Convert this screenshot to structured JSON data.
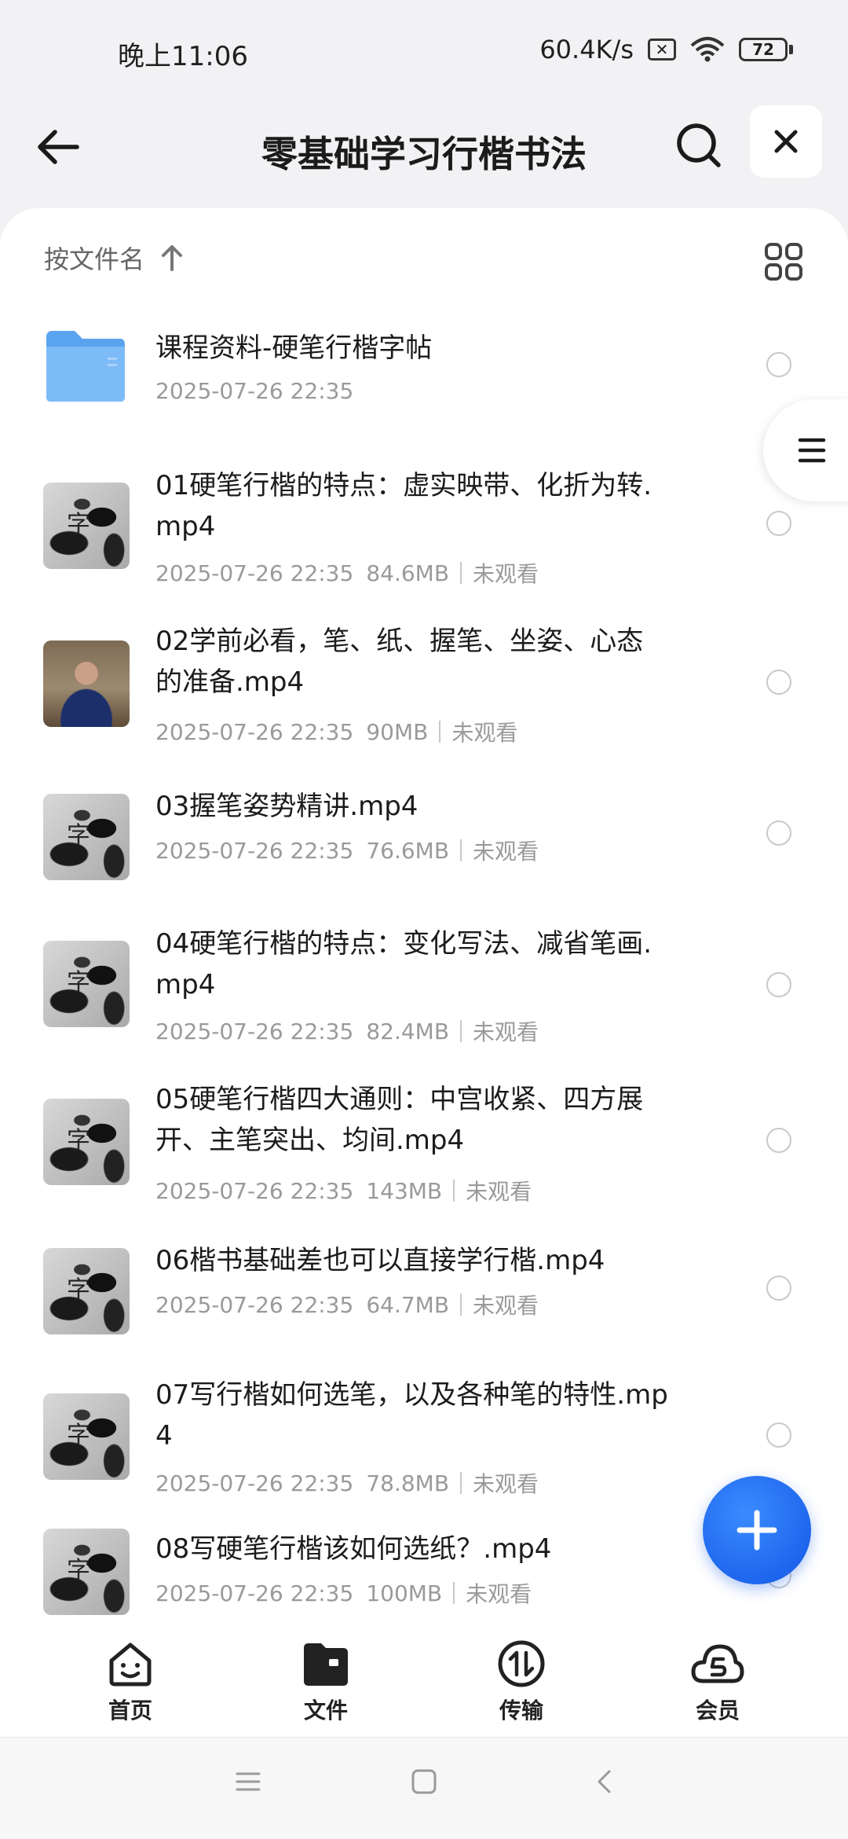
{
  "status": {
    "time": "晚上11:06",
    "speed": "60.4K/s",
    "battery": "72"
  },
  "header": {
    "title": "零基础学习行楷书法"
  },
  "sort": {
    "label": "按文件名"
  },
  "files": [
    {
      "name": "课程资料-硬笔行楷字帖",
      "date": "2025-07-26 22:35",
      "size": "",
      "status": "",
      "kind": "folder"
    },
    {
      "name": "01硬笔行楷的特点：虚实映带、化折为转.mp4",
      "line1": "01硬笔行楷的特点：虚实映带、化折为转.",
      "line2": "mp4",
      "date": "2025-07-26 22:35",
      "size": "84.6MB",
      "status": "未观看",
      "kind": "video"
    },
    {
      "name": "02学前必看，笔、纸、握笔、坐姿、心态的准备.mp4",
      "line1": "02学前必看，笔、纸、握笔、坐姿、心态",
      "line2": "的准备.mp4",
      "date": "2025-07-26 22:35",
      "size": "90MB",
      "status": "未观看",
      "kind": "video"
    },
    {
      "name": "03握笔姿势精讲.mp4",
      "date": "2025-07-26 22:35",
      "size": "76.6MB",
      "status": "未观看",
      "kind": "video"
    },
    {
      "name": "04硬笔行楷的特点：变化写法、减省笔画.mp4",
      "line1": "04硬笔行楷的特点：变化写法、减省笔画.",
      "line2": "mp4",
      "date": "2025-07-26 22:35",
      "size": "82.4MB",
      "status": "未观看",
      "kind": "video"
    },
    {
      "name": "05硬笔行楷四大通则：中宫收紧、四方展开、主笔突出、均间.mp4",
      "line1": "05硬笔行楷四大通则：中宫收紧、四方展",
      "line2": "开、主笔突出、均间.mp4",
      "date": "2025-07-26 22:35",
      "size": "143MB",
      "status": "未观看",
      "kind": "video"
    },
    {
      "name": "06楷书基础差也可以直接学行楷.mp4",
      "date": "2025-07-26 22:35",
      "size": "64.7MB",
      "status": "未观看",
      "kind": "video"
    },
    {
      "name": "07写行楷如何选笔，以及各种笔的特性.mp4",
      "line1": "07写行楷如何选笔，以及各种笔的特性.mp",
      "line2": "4",
      "date": "2025-07-26 22:35",
      "size": "78.8MB",
      "status": "未观看",
      "kind": "video"
    },
    {
      "name": "08写硬笔行楷该如何选纸？.mp4",
      "date": "2025-07-26 22:35",
      "size": "100MB",
      "status": "未观看",
      "kind": "video"
    }
  ],
  "thumb_glyph": "字",
  "nav": [
    {
      "label": "首页",
      "icon": "home-face-icon"
    },
    {
      "label": "文件",
      "icon": "folder-icon"
    },
    {
      "label": "传输",
      "icon": "transfer-icon"
    },
    {
      "label": "会员",
      "icon": "vip-cloud-icon"
    }
  ],
  "colors": {
    "accent": "#1a66f0",
    "fab": "#1257e6",
    "folder": "#6fb3f5"
  }
}
